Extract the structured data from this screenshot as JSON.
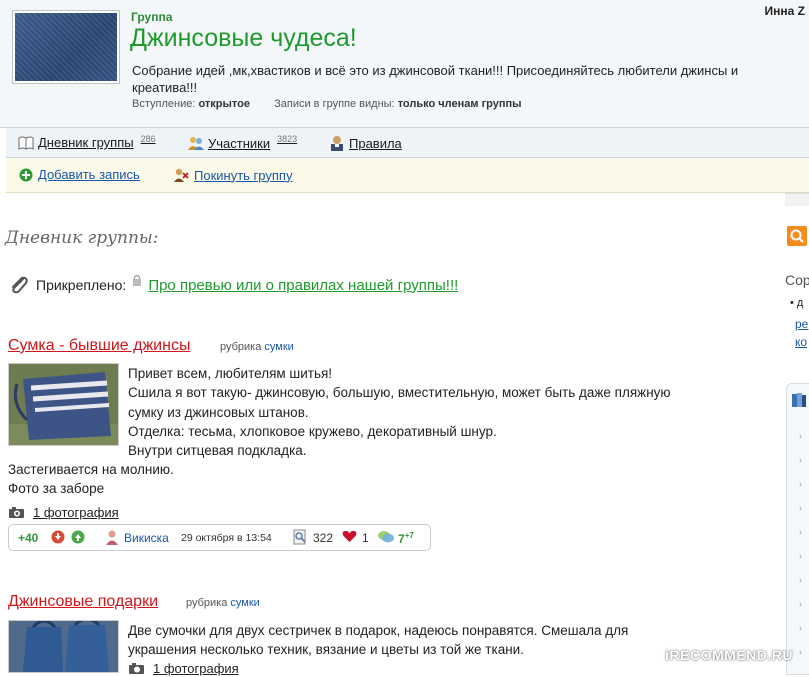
{
  "header": {
    "kicker": "Группа",
    "title": "Джинсовые чудеса!",
    "user": "Инна Z",
    "description": "Собрание идей ,мк,хвастиков и всё это из джинсовой ткани!!! Присоединяйтесь любители джинсы и креатива!!!",
    "join_label": "Вступление:",
    "join_value": "открытое",
    "visible_label": "Записи в группе видны:",
    "visible_value": "только членам группы"
  },
  "tabs": {
    "diary": {
      "label": "Дневник группы",
      "count": "286"
    },
    "members": {
      "label": "Участники",
      "count": "3823"
    },
    "rules": {
      "label": "Правила"
    }
  },
  "actions": {
    "add": "Добавить запись",
    "leave": "Покинуть группу"
  },
  "section_title": "Дневник группы:",
  "pinned": {
    "label": "Прикреплено:",
    "link": "Про превью или о правилах нашей группы!!!"
  },
  "posts": [
    {
      "title": "Сумка - бывшие джинсы",
      "rubric_label": "рубрика",
      "rubric": "сумки",
      "lines": [
        "Привет всем, любителям шитья!",
        "Сшила я вот такую- джинсовую, большую, вместительную, может быть даже пляжную",
        "сумку из джинсовых штанов.",
        "Отделка: тесьма, хлопковое кружево, декоративный шнур.",
        "Внутри ситцевая подкладка.",
        "Застегивается на молнию.",
        "Фото за заборе"
      ],
      "photos": "1 фотография",
      "rating": "+40",
      "author": "Викиска",
      "date": "29 октября в 13:54",
      "views": "322",
      "likes": "1",
      "comments": "7",
      "comments_new": "+7"
    },
    {
      "title": "Джинсовые подарки",
      "rubric_label": "рубрика",
      "rubric": "сумки",
      "lines": [
        "Две сумочки для двух сестричек в подарок, надеюсь понравятся. Смешала для",
        "украшения несколько техник, вязание и цветы из той же ткани."
      ],
      "photos": "1 фотография"
    }
  ],
  "sidebar": {
    "heading_partial": "Сор",
    "link1_partial": "ре",
    "link2_partial": "ко"
  },
  "watermark": "iRECOMMEND.RU",
  "colors": {
    "title_green": "#1e9a2d",
    "post_red": "#d0161a",
    "link_blue": "#1a57a8"
  }
}
